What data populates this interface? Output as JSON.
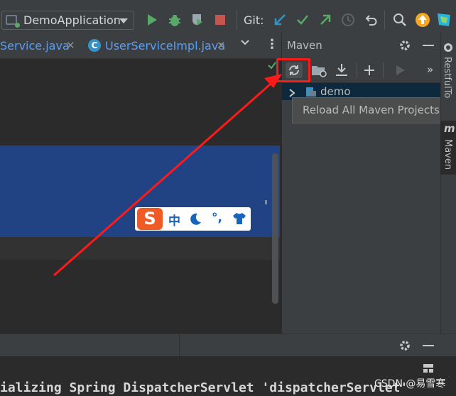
{
  "toolbar": {
    "run_config": "DemoApplication",
    "git_label": "Git:",
    "icons": [
      "run-icon",
      "debug-icon",
      "coverage-icon",
      "stop-icon",
      "git-update-icon",
      "git-commit-icon",
      "git-push-icon",
      "history-icon",
      "rollback-icon",
      "search-icon",
      "update-icon",
      "toolbox-icon"
    ]
  },
  "tabs": [
    {
      "label": "Service.java"
    },
    {
      "label": "UserServiceImpl.java",
      "badge": "C"
    }
  ],
  "maven": {
    "title": "Maven",
    "tree_root": "demo",
    "tooltip": "Reload All Maven Projects",
    "more": "»"
  },
  "right_stripe": {
    "restful_tab": "RestfulTo",
    "maven_tab": "Maven",
    "maven_icon_letter": "m"
  },
  "ime": {
    "logo": "S",
    "mode": "中"
  },
  "console": {
    "line": "ializing Spring DispatcherServlet 'dispatcherServlet'"
  },
  "watermark": "CSDN @易雪寒",
  "colors": {
    "accent_red": "#ff1a1a",
    "selection": "#214283",
    "tab_text": "#589df6"
  }
}
